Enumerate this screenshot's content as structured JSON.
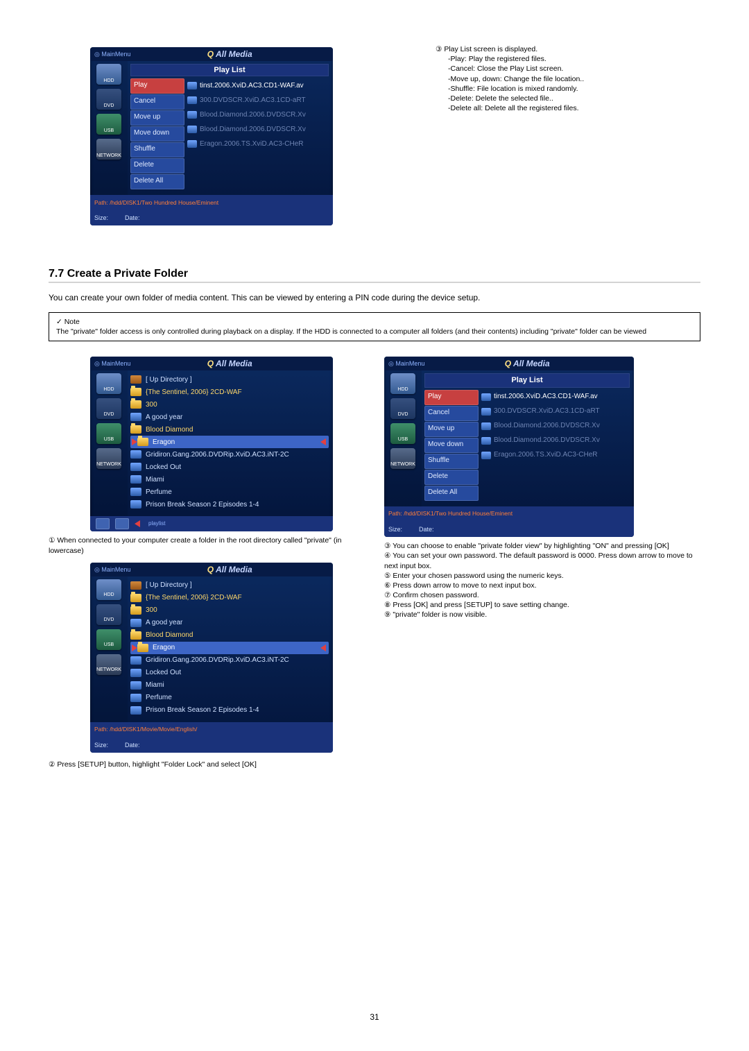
{
  "page_number": "31",
  "top": {
    "playlist": {
      "header": "Play List",
      "menu": [
        "Play",
        "Cancel",
        "Move up",
        "Move down",
        "Shuffle",
        "Delete",
        "Delete All"
      ],
      "active_file": "tinst.2006.XviD.AC3.CD1-WAF.av",
      "faded_files": [
        "300.DVDSCR.XviD.AC3.1CD-aRT",
        "Blood.Diamond.2006.DVDSCR.Xv",
        "Blood.Diamond.2006.DVDSCR.Xv",
        "Eragon.2006.TS.XviD.AC3-CHeR"
      ],
      "footer_path": "Path: /hdd/DISK1/Two Hundred House/Eminent",
      "footer_size": "Size:",
      "footer_date": "Date:"
    },
    "instructions": {
      "lead": "③ Play List screen is displayed.",
      "items": [
        "-Play: Play the registered files.",
        "-Cancel: Close the Play List screen.",
        "-Move up, down: Change the file location..",
        "-Shuffle: File location is mixed randomly.",
        "-Delete: Delete the selected file..",
        "-Delete all: Delete all the registered files."
      ]
    }
  },
  "section": {
    "title": "7.7 Create a Private Folder",
    "intro": "You can create your own folder of media content. This can be viewed by entering a PIN code during the device setup."
  },
  "note": {
    "label": "✓  Note",
    "text": "The \"private\" folder access is only controlled during playback on a display. If the HDD is connected to a computer all folders (and their contents) including \"private\" folder can be viewed"
  },
  "common": {
    "mainmenu": "◎ MainMenu",
    "title_q": "Q",
    "title_rest": " All Media",
    "side": {
      "hdd": "HDD",
      "dvd": "DVD",
      "usb": "USB",
      "net": "NETWORK"
    },
    "footer_size": "Size:",
    "footer_date": "Date:"
  },
  "left": {
    "list1": {
      "rows": [
        {
          "icon": "up",
          "text": "[ Up Directory ]"
        },
        {
          "icon": "folder",
          "text": "{The Sentinel, 2006} 2CD-WAF"
        },
        {
          "icon": "folder",
          "text": "300"
        },
        {
          "icon": "file",
          "text": "A good year"
        },
        {
          "icon": "folder",
          "text": "Blood Diamond"
        },
        {
          "icon": "folder",
          "text": "Eragon",
          "sel": true,
          "arrows": true
        },
        {
          "icon": "file",
          "text": "Gridiron.Gang.2006.DVDRip.XviD.AC3.iNT-2C"
        },
        {
          "icon": "file",
          "text": "Locked Out"
        },
        {
          "icon": "file",
          "text": "Miami"
        },
        {
          "icon": "file",
          "text": "Perfume"
        },
        {
          "icon": "file",
          "text": "Prison Break Season 2 Episodes 1-4"
        }
      ],
      "tool_label": "playlist"
    },
    "caption1": "① When connected to your computer create a folder in the root directory called \"private\" (in lowercase)",
    "list2": {
      "rows": [
        {
          "icon": "up",
          "text": "[ Up Directory ]"
        },
        {
          "icon": "folder",
          "text": "{The Sentinel, 2006} 2CD-WAF"
        },
        {
          "icon": "folder",
          "text": "300"
        },
        {
          "icon": "file",
          "text": "A good year"
        },
        {
          "icon": "folder",
          "text": "Blood Diamond"
        },
        {
          "icon": "folder",
          "text": "Eragon",
          "sel": true,
          "arrows": true
        },
        {
          "icon": "file",
          "text": "Gridiron.Gang.2006.DVDRip.XviD.AC3.iNT-2C"
        },
        {
          "icon": "file",
          "text": "Locked Out"
        },
        {
          "icon": "file",
          "text": "Miami"
        },
        {
          "icon": "file",
          "text": "Perfume"
        },
        {
          "icon": "file",
          "text": "Prison Break Season 2 Episodes 1-4"
        }
      ],
      "footer_path": "Path: /hdd/DISK1/Movie/Movie/English/"
    },
    "caption2": "② Press [SETUP] button, highlight \"Folder Lock\" and select [OK]"
  },
  "right": {
    "playlist": {
      "header": "Play List",
      "menu": [
        "Play",
        "Cancel",
        "Move up",
        "Move down",
        "Shuffle",
        "Delete",
        "Delete All"
      ],
      "active_file": "tinst.2006.XviD.AC3.CD1-WAF.av",
      "faded_files": [
        "300.DVDSCR.XviD.AC3.1CD-aRT",
        "Blood.Diamond.2006.DVDSCR.Xv",
        "Blood.Diamond.2006.DVDSCR.Xv",
        "Eragon.2006.TS.XviD.AC3-CHeR"
      ],
      "footer_path": "Path: /hdd/DISK1/Two Hundred House/Eminent"
    },
    "steps": [
      "③ You can choose to enable \"private folder view\" by highlighting \"ON\" and pressing [OK]",
      "④ You can set your own password. The default password is 0000. Press down arrow to move to next input box.",
      "⑤ Enter your chosen password using the numeric keys.",
      "⑥ Press down arrow to move to next input box.",
      "⑦ Confirm chosen password.",
      "⑧ Press [OK] and press [SETUP] to save setting change.",
      "⑨ \"private\" folder is now visible."
    ]
  }
}
